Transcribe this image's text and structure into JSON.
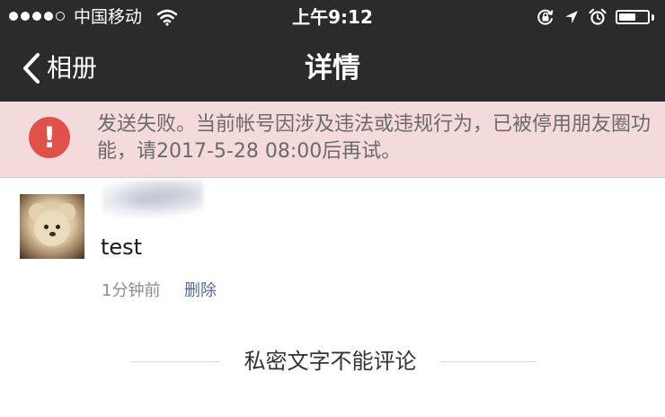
{
  "status_bar": {
    "carrier": "中国移动",
    "time": "上午9:12",
    "signal_bars_filled": 4,
    "signal_bars_total": 5,
    "battery_level": 0.6
  },
  "nav": {
    "back_label": "相册",
    "title": "详情"
  },
  "error_banner": {
    "icon": "!",
    "message": "发送失败。当前帐号因涉及违法或违规行为，已被停用朋友圈功能，请2017-5-28 08:00后再试。",
    "accent_color": "#e0514c",
    "background_color": "#f4dada"
  },
  "post": {
    "text": "test",
    "time": "1分钟前",
    "delete_label": "删除",
    "link_color": "#576b95"
  },
  "footer_note": "私密文字不能评论"
}
